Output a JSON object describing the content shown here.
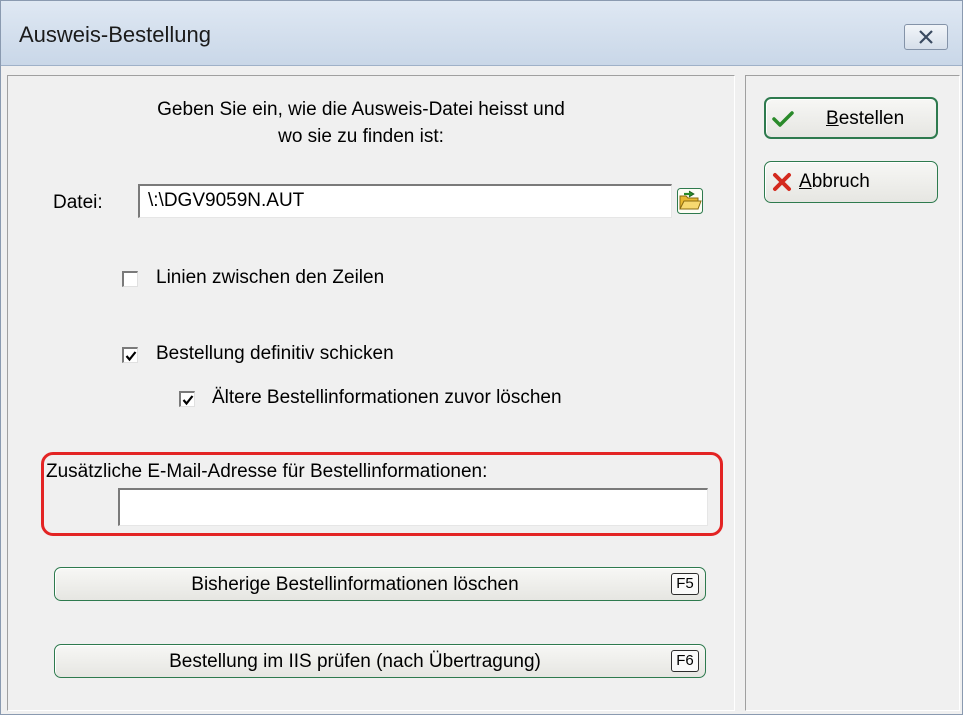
{
  "window": {
    "title": "Ausweis-Bestellung",
    "close_icon": "close-icon"
  },
  "instructions": {
    "line1": "Geben Sie ein, wie die Ausweis-Datei heisst und",
    "line2": "wo sie zu finden ist:"
  },
  "file": {
    "label": "Datei:",
    "value": "\\:\\DGV9059N.AUT",
    "browse_icon": "folder-open-icon"
  },
  "checkboxes": [
    {
      "label": "Linien zwischen den Zeilen",
      "checked": false
    },
    {
      "label": "Bestellung definitiv schicken",
      "checked": true
    },
    {
      "label": "Ältere Bestellinformationen zuvor löschen",
      "checked": true
    }
  ],
  "email": {
    "label": "Zusätzliche E-Mail-Adresse für Bestellinformationen:",
    "value": "",
    "highlight_color": "#e32424"
  },
  "actions": {
    "delete_label": "Bisherige Bestellinformationen löschen",
    "delete_key": "F5",
    "check_label": "Bestellung im IIS prüfen (nach Übertragung)",
    "check_key": "F6"
  },
  "side": {
    "order_label_first": "B",
    "order_label_rest": "estellen",
    "cancel_label_first": "A",
    "cancel_label_rest": "bbruch"
  },
  "colors": {
    "button_border": "#2e7a4e",
    "check_green": "#2a8a2a",
    "cancel_red": "#d42a1e"
  }
}
